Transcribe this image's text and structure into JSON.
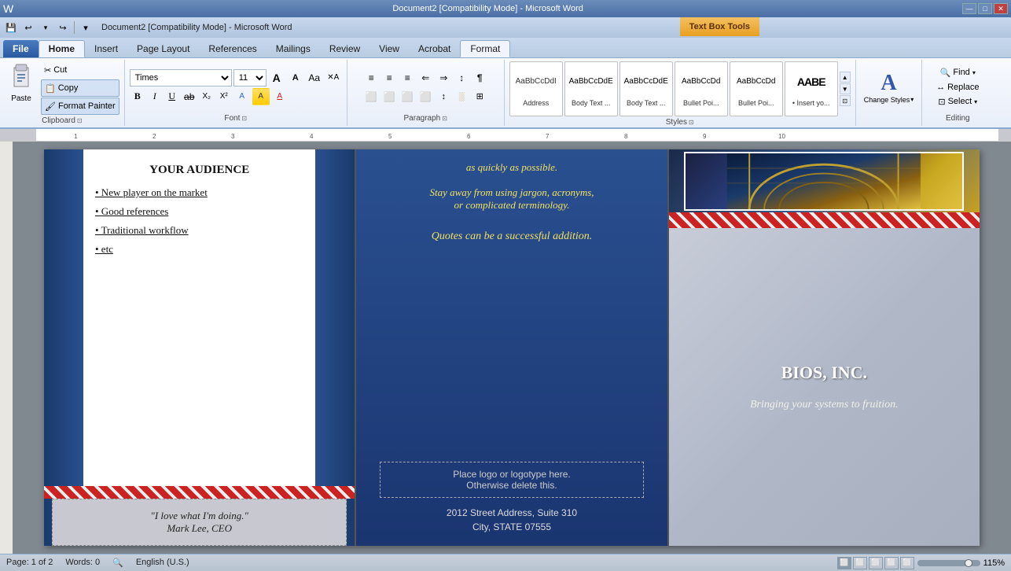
{
  "titleBar": {
    "title": "Document2 [Compatibility Mode] - Microsoft Word",
    "textBoxTools": "Text Box Tools",
    "winBtns": [
      "—",
      "□",
      "✕"
    ]
  },
  "quickAccess": {
    "buttons": [
      "💾",
      "↩",
      "↪",
      "⊟"
    ]
  },
  "ribbonTabs": {
    "file": "File",
    "home": "Home",
    "insert": "Insert",
    "pageLayout": "Page Layout",
    "references": "References",
    "mailings": "Mailings",
    "review": "Review",
    "view": "View",
    "acrobat": "Acrobat",
    "format": "Format"
  },
  "clipboard": {
    "groupLabel": "Clipboard",
    "paste": "Paste",
    "cut": "Cut",
    "copy": "Copy",
    "formatPainter": "Format Painter"
  },
  "font": {
    "groupLabel": "Font",
    "fontName": "Times",
    "fontSize": "11",
    "growBtn": "A",
    "shrinkBtn": "A",
    "clearFormatBtn": "Aa",
    "boldBtn": "B",
    "italicBtn": "I",
    "underlineBtn": "U",
    "strikeBtn": "ab",
    "subBtn": "X₂",
    "superBtn": "X²",
    "highlightBtn": "A",
    "colorBtn": "A"
  },
  "paragraph": {
    "groupLabel": "Paragraph",
    "bullets": "≡",
    "numbering": "≡",
    "multilevel": "≡",
    "decreaseIndent": "⇐",
    "increaseIndent": "⇒",
    "sort": "↕",
    "showHide": "¶",
    "alignLeft": "≡",
    "alignCenter": "≡",
    "alignRight": "≡",
    "justify": "≡",
    "lineSpacing": "≡",
    "shading": "░",
    "borders": "□"
  },
  "styles": {
    "groupLabel": "Styles",
    "items": [
      {
        "label": "Address",
        "preview": "Address",
        "style": "normal"
      },
      {
        "label": "Body Text ...",
        "preview": "AaBbCcDe",
        "style": "body"
      },
      {
        "label": "Body Text ...",
        "preview": "AaBbCcDe",
        "style": "body2"
      },
      {
        "label": "Bullet Poi...",
        "preview": "AaBbCcDd",
        "style": "bullet"
      },
      {
        "label": "Bullet Poi...",
        "preview": "AaBbCcDd",
        "style": "bullet2"
      },
      {
        "label": "Insert yo...",
        "preview": "• Insert yo...",
        "style": "insert"
      }
    ],
    "changeStyles": "Change Styles"
  },
  "editing": {
    "groupLabel": "Editing",
    "find": "Find",
    "replace": "Replace",
    "select": "Select"
  },
  "document": {
    "panel1": {
      "title": "YOUR AUDIENCE",
      "bullets": [
        "• New player on the market",
        "• Good references",
        "• Traditional workflow",
        "• etc"
      ],
      "quote": "\"I love what I'm doing.\"\nMark Lee, CEO"
    },
    "panel2": {
      "lines": [
        "as quickly as possible.",
        "",
        "Stay away from using jargon, acronyms,",
        "or complicated terminology.",
        "",
        "Quotes can be a successful addition."
      ],
      "logoPlaceholder": "Place logo  or logotype here.",
      "logoSubtext": "Otherwise delete this.",
      "address1": "2012 Street Address,  Suite 310",
      "address2": "City, STATE 07555"
    },
    "panel3": {
      "title": "BIOS, INC.",
      "tagline": "Bringing your systems to fruition."
    }
  },
  "statusBar": {
    "page": "Page: 1 of 2",
    "words": "Words: 0",
    "language": "English (U.S.)",
    "zoom": "115%"
  }
}
